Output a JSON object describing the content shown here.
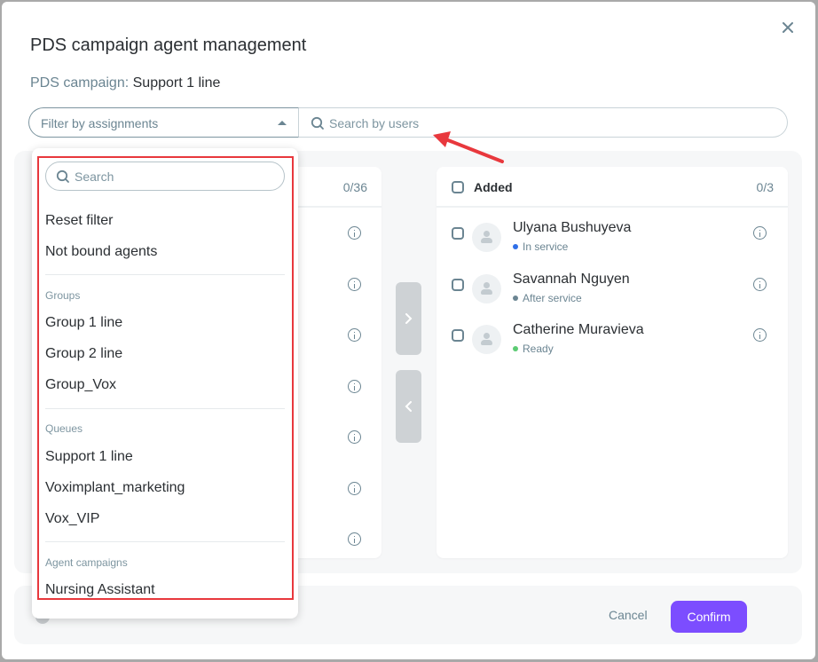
{
  "modal": {
    "title": "PDS campaign agent management",
    "campaign_label": "PDS campaign:",
    "campaign_value": "Support 1 line"
  },
  "filter": {
    "placeholder": "Filter by assignments",
    "expanded": true
  },
  "user_search": {
    "placeholder": "Search by users",
    "value": ""
  },
  "dropdown": {
    "search_placeholder": "Search",
    "actions": [
      "Reset filter",
      "Not bound agents"
    ],
    "sections": [
      {
        "label": "Groups",
        "items": [
          "Group 1 line",
          "Group 2 line",
          "Group_Vox"
        ]
      },
      {
        "label": "Queues",
        "items": [
          "Support 1 line",
          "Voximplant_marketing",
          "Vox_VIP"
        ]
      },
      {
        "label": "Agent campaigns",
        "items": [
          "Nursing Assistant"
        ]
      }
    ]
  },
  "available_panel": {
    "count": "0/36"
  },
  "added_panel": {
    "label": "Added",
    "count": "0/3",
    "agents": [
      {
        "name": "Ulyana Bushuyeva",
        "status": "In service",
        "status_color": "#2f6fe8"
      },
      {
        "name": "Savannah Nguyen",
        "status": "After service",
        "status_color": "#6b8592"
      },
      {
        "name": "Catherine Muravieva",
        "status": "Ready",
        "status_color": "#5ccb73"
      }
    ]
  },
  "footer": {
    "cancel_label": "Cancel",
    "confirm_label": "Confirm"
  },
  "colors": {
    "accent": "#7c4dff",
    "highlight": "#e8383d"
  }
}
